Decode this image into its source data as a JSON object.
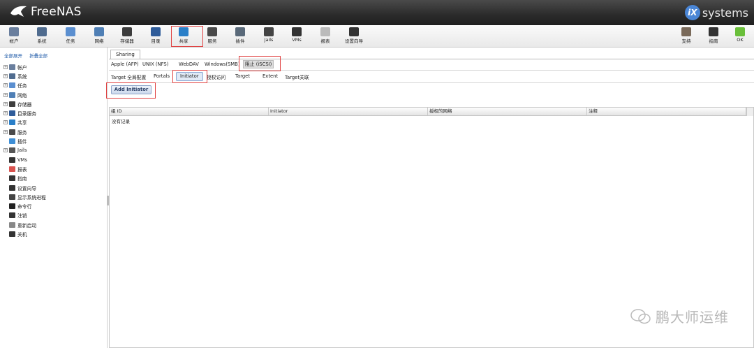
{
  "app": {
    "name": "FreeNAS",
    "vendor": "systems",
    "vendor_badge": "iX"
  },
  "toolbar": {
    "left": [
      {
        "key": "account",
        "label": "帐户",
        "icon": "users-icon",
        "color": "#6a7f9e"
      },
      {
        "key": "system",
        "label": "系统",
        "icon": "system-icon",
        "color": "#506c8f"
      },
      {
        "key": "tasks",
        "label": "任务",
        "icon": "tasks-icon",
        "color": "#5b8fd0"
      },
      {
        "key": "network",
        "label": "网络",
        "icon": "network-icon",
        "color": "#4f7fb5"
      },
      {
        "key": "storage",
        "label": "存储器",
        "icon": "storage-icon",
        "color": "#3d3d3d"
      },
      {
        "key": "directory",
        "label": "目录",
        "icon": "directory-icon",
        "color": "#2f5c9a"
      },
      {
        "key": "sharing",
        "label": "共享",
        "icon": "sharing-icon",
        "color": "#2a7fc8"
      },
      {
        "key": "services",
        "label": "服务",
        "icon": "services-icon",
        "color": "#4a4a4a"
      },
      {
        "key": "plugins",
        "label": "插件",
        "icon": "plugins-icon",
        "color": "#5a6a7a"
      },
      {
        "key": "jails",
        "label": "Jails",
        "icon": "jails-icon",
        "color": "#444"
      },
      {
        "key": "vms",
        "label": "VMs",
        "icon": "vms-icon",
        "color": "#333"
      },
      {
        "key": "reports",
        "label": "报表",
        "icon": "reports-icon",
        "color": "#bbb"
      },
      {
        "key": "wizard",
        "label": "设置向导",
        "icon": "wizard-icon",
        "color": "#333"
      }
    ],
    "right": [
      {
        "key": "support",
        "label": "支持",
        "icon": "support-icon",
        "color": "#7a6a5a"
      },
      {
        "key": "guide",
        "label": "指南",
        "icon": "guide-icon",
        "color": "#333"
      },
      {
        "key": "ok",
        "label": "OK",
        "icon": "ok-status-icon",
        "color": "#6abf3a"
      }
    ]
  },
  "tree": {
    "expand_all": "全部展开",
    "collapse_all": "折叠全部",
    "items": [
      {
        "label": "帐户",
        "exp": true,
        "icon": "users-icon",
        "color": "#6a7f9e"
      },
      {
        "label": "系统",
        "exp": true,
        "icon": "system-icon",
        "color": "#506c8f"
      },
      {
        "label": "任务",
        "exp": true,
        "icon": "tasks-icon",
        "color": "#5b8fd0"
      },
      {
        "label": "网络",
        "exp": true,
        "icon": "network-icon",
        "color": "#4f7fb5"
      },
      {
        "label": "存储器",
        "exp": true,
        "icon": "storage-icon",
        "color": "#3d3d3d"
      },
      {
        "label": "目录服务",
        "exp": true,
        "icon": "directory-icon",
        "color": "#2f5c9a"
      },
      {
        "label": "共享",
        "exp": true,
        "icon": "sharing-icon",
        "color": "#2a7fc8"
      },
      {
        "label": "服务",
        "exp": true,
        "icon": "services-icon",
        "color": "#4a4a4a"
      },
      {
        "label": "插件",
        "exp": false,
        "icon": "plugins-icon",
        "color": "#3f8fd6"
      },
      {
        "label": "Jails",
        "exp": true,
        "icon": "jails-icon",
        "color": "#555"
      },
      {
        "label": "VMs",
        "exp": false,
        "icon": "vms-icon",
        "color": "#333"
      },
      {
        "label": "报表",
        "exp": false,
        "icon": "reports-icon",
        "color": "#d9534f"
      },
      {
        "label": "指南",
        "exp": false,
        "icon": "guide-icon",
        "color": "#333"
      },
      {
        "label": "设置向导",
        "exp": false,
        "icon": "wizard-icon",
        "color": "#333"
      },
      {
        "label": "显示系统进程",
        "exp": false,
        "icon": "process-icon",
        "color": "#444"
      },
      {
        "label": "命令行",
        "exp": false,
        "icon": "shell-icon",
        "color": "#222"
      },
      {
        "label": "注销",
        "exp": false,
        "icon": "logout-icon",
        "color": "#333"
      },
      {
        "label": "重新启动",
        "exp": false,
        "icon": "reboot-icon",
        "color": "#888"
      },
      {
        "label": "关机",
        "exp": false,
        "icon": "shutdown-icon",
        "color": "#333"
      }
    ]
  },
  "main": {
    "tab": "Sharing",
    "sharing_tabs": [
      "Apple (AFP)",
      "UNIX (NFS)",
      "WebDAV",
      "Windows(SMB)",
      "阻止 (iSCSI)"
    ],
    "iscsi_tabs": [
      "Target 全局配置",
      "Portals",
      "Initiator",
      "授权访问",
      "Target",
      "Extent",
      "Target关联"
    ],
    "add_button": "Add Initiator",
    "grid": {
      "columns": [
        "组 ID",
        "Initiator",
        "授权的网络",
        "注释"
      ],
      "empty_text": "没有记录"
    }
  },
  "watermark": "鹏大师运维",
  "colors": {
    "header_bg": "#2b2b2b",
    "highlight": "#e04040",
    "link": "#1e5aa8"
  }
}
